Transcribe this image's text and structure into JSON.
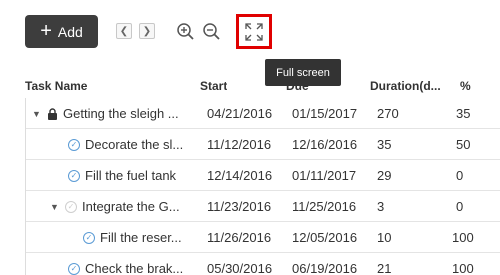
{
  "toolbar": {
    "add_label": "Add",
    "add_icon": "plus-icon",
    "prev_icon": "chevron-left-icon",
    "next_icon": "chevron-right-icon",
    "zoom_in_icon": "zoom-in-icon",
    "zoom_out_icon": "zoom-out-icon",
    "fullscreen_icon": "fullscreen-icon"
  },
  "tooltip": {
    "text": "Full screen"
  },
  "columns": {
    "task_name": "Task Name",
    "start": "Start",
    "due": "Due",
    "duration": "Duration(d...",
    "percent": "%"
  },
  "rows": [
    {
      "name": "Getting the sleigh ...",
      "start": "04/21/2016",
      "due": "01/15/2017",
      "duration": "270",
      "percent": "35"
    },
    {
      "name": "Decorate the sl...",
      "start": "11/12/2016",
      "due": "12/16/2016",
      "duration": "35",
      "percent": "50"
    },
    {
      "name": "Fill the fuel tank",
      "start": "12/14/2016",
      "due": "01/11/2017",
      "duration": "29",
      "percent": "0"
    },
    {
      "name": "Integrate the G...",
      "start": "11/23/2016",
      "due": "11/25/2016",
      "duration": "3",
      "percent": "0"
    },
    {
      "name": "Fill the reser...",
      "start": "11/26/2016",
      "due": "12/05/2016",
      "duration": "10",
      "percent": "100"
    },
    {
      "name": "Check the brak...",
      "start": "05/30/2016",
      "due": "06/19/2016",
      "duration": "21",
      "percent": "100"
    }
  ],
  "colors": {
    "accent": "#5b9bd5",
    "highlight": "#e00000",
    "button_bg": "#3d3d3d"
  }
}
